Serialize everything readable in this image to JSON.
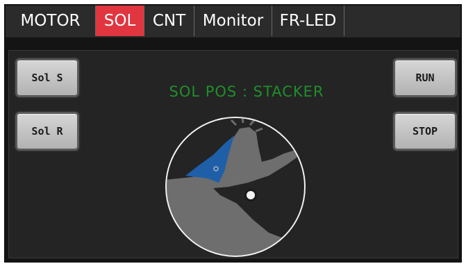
{
  "tabs": [
    {
      "label": "MOTOR",
      "active": false
    },
    {
      "label": "SOL",
      "active": true
    },
    {
      "label": "CNT",
      "active": false
    },
    {
      "label": "Monitor",
      "active": false
    },
    {
      "label": "FR-LED",
      "active": false
    }
  ],
  "buttons": {
    "sol_s": "Sol S",
    "sol_r": "Sol R",
    "run": "RUN",
    "stop": "STOP"
  },
  "status": {
    "text": "SOL POS : STACKER"
  },
  "colors": {
    "active_tab": "#e1353f",
    "status_text": "#1f8f2a",
    "solenoid_highlight": "#1f5fa8"
  }
}
